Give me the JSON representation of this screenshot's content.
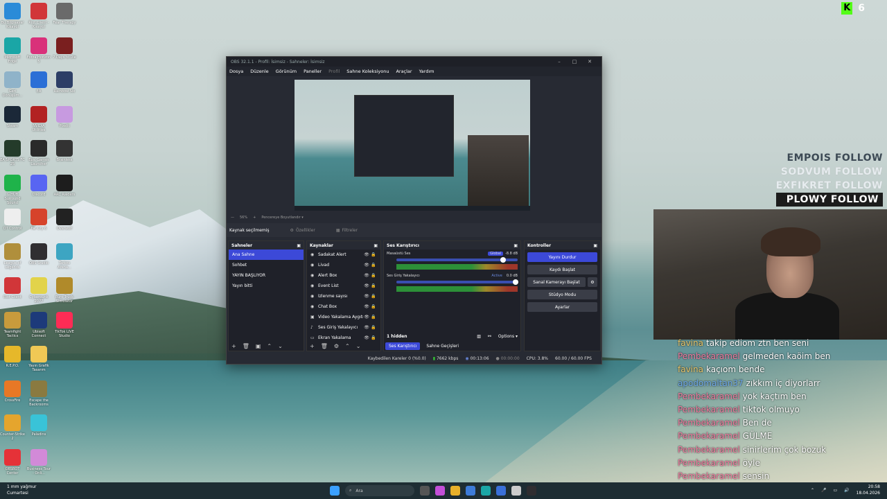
{
  "desktop": {
    "icons": [
      {
        "label": "Bu Bilgisayar Kısayol",
        "color": "#2a8bd8"
      },
      {
        "label": "Riot Client - Kısayol",
        "color": "#d13639"
      },
      {
        "label": "Fear Therapy",
        "color": "#6a6a6a"
      },
      {
        "label": "Microsoft Edge",
        "color": "#1aa6a6"
      },
      {
        "label": "Forza Horizon 5",
        "color": "#d9317a"
      },
      {
        "label": "7 Days to Die",
        "color": "#7a1f1f"
      },
      {
        "label": "Geri Dönüşüm...",
        "color": "#8fb3c9"
      },
      {
        "label": "EA",
        "color": "#2b6fd6"
      },
      {
        "label": "Rainbow Six",
        "color": "#2c3e66"
      },
      {
        "label": "Steam",
        "color": "#1b2838"
      },
      {
        "label": "NVIDIA Utilities",
        "color": "#b22222"
      },
      {
        "label": "Pixelit",
        "color": "#c79ae0"
      },
      {
        "label": "EA SPORTS FC 25",
        "color": "#243b2a"
      },
      {
        "label": "Epic Games Launcher",
        "color": "#2a2a2a"
      },
      {
        "label": "Brainless",
        "color": "#333333"
      },
      {
        "label": "G HUB Surround Sound",
        "color": "#1fb34a"
      },
      {
        "label": "Discord",
        "color": "#5865f2"
      },
      {
        "label": "ARC Raiders",
        "color": "#1d1d1d"
      },
      {
        "label": "OT Control",
        "color": "#eeeeee"
      },
      {
        "label": "Far Cry 6",
        "color": "#d6432b"
      },
      {
        "label": "Overwolf",
        "color": "#222222"
      },
      {
        "label": "League of Legends",
        "color": "#b08f3c"
      },
      {
        "label": "OBS Studio",
        "color": "#302e31"
      },
      {
        "label": "Tarkov Arena...",
        "color": "#3da5c2"
      },
      {
        "label": "Riot Client",
        "color": "#d13639"
      },
      {
        "label": "Cyberpunk 2077",
        "color": "#e2d34a"
      },
      {
        "label": "Euro Truck Simulator",
        "color": "#b08a2a"
      },
      {
        "label": "Teamfight Tactics",
        "color": "#c89b3c"
      },
      {
        "label": "Ubisoft Connect",
        "color": "#1d3a7a"
      },
      {
        "label": "TikTok LIVE Studio",
        "color": "#fe2c55"
      },
      {
        "label": "R.E.P.O.",
        "color": "#e6b82a"
      },
      {
        "label": "Yayın Grafik Tasarım",
        "color": "#f0c855"
      },
      {
        "label": "CrossFire",
        "color": "#e77826"
      },
      {
        "label": "Escape the Backrooms",
        "color": "#8a7a40"
      },
      {
        "label": "Counter-Strike 2",
        "color": "#e5a52d"
      },
      {
        "label": "Paladins",
        "color": "#39c3d8"
      },
      {
        "label": "OBSBOT Center",
        "color": "#e53238"
      },
      {
        "label": "Business Tour - Onli...",
        "color": "#d28ad8"
      }
    ]
  },
  "obs": {
    "title": "OBS 32.1.1 - Profil: İsimsiz - Sahneler: İsimsiz",
    "menu": [
      "Dosya",
      "Düzenle",
      "Görünüm",
      "Paneller",
      "Profil",
      "Sahne Koleksiyonu",
      "Araçlar",
      "Yardım"
    ],
    "preview_toolbar": {
      "zoom": "56%",
      "fit": "Pencereye Boyutlandır"
    },
    "source_bar": {
      "label": "Kaynak seçilmemiş",
      "props": "Özellikler",
      "filters": "Filtreler"
    },
    "scenes": {
      "header": "Sahneler",
      "items": [
        "Ana Sahne",
        "Sohbet",
        "YAYIN BAŞLIYOR",
        "Yayın bitti"
      ],
      "active": "Ana Sahne"
    },
    "sources": {
      "header": "Kaynaklar",
      "items": [
        "Sadakat Alert",
        "Livad",
        "Alert Box",
        "Event List",
        "İzlenme sayısı",
        "Chat Box",
        "Video Yakalama Aygıtı",
        "Ses Giriş Yakalayıcı",
        "Ekran Yakalama"
      ]
    },
    "mixer": {
      "header": "Ses Karıştırıcı",
      "tracks": [
        {
          "name": "Masaüstü Ses",
          "tag": "Global",
          "db": "-8.8 dB",
          "level": 0.88
        },
        {
          "name": "Ses Giriş Yakalayıcı",
          "tag": "Active",
          "db": "0.0 dB",
          "level": 0.98
        }
      ],
      "hidden": "1 hidden",
      "options": "Options",
      "tabs": [
        "Ses Karıştırıcı",
        "Sahne Geçişleri"
      ]
    },
    "controls": {
      "header": "Kontroller",
      "buttons": [
        "Yayını Durdur",
        "Kaydı Başlat",
        "Sanal Kamerayı Başlat",
        "Stüdyo Modu",
        "Ayarlar"
      ]
    },
    "status": {
      "dropped": "Kaybedilen Kareler 0 (%0.0)",
      "bitrate": "7662 kbps",
      "stream_time": "00:13:06",
      "rec_time": "00:00:00",
      "cpu": "CPU: 3.8%",
      "fps": "60.00 / 60.00 FPS"
    }
  },
  "kick": {
    "viewers": "6"
  },
  "follows": [
    "EMPOIS FOLLOW",
    "SODVUM FOLLOW",
    "EXFIKRET FOLLOW",
    "PLOWY FOLLOW"
  ],
  "chat": [
    {
      "user": "favina",
      "msg": "takip ediom ztn ben seni",
      "cls": "favina"
    },
    {
      "user": "Pembekaramel",
      "msg": "gelmeden kaöim ben",
      "cls": "pembe"
    },
    {
      "user": "favina",
      "msg": "kaçıom bende",
      "cls": "favina"
    },
    {
      "user": "apodomaltan37",
      "msg": "zıkkım iç diyorlarr",
      "cls": "apo"
    },
    {
      "user": "Pembekaramel",
      "msg": "yok kaçtım ben",
      "cls": "pembe"
    },
    {
      "user": "Pembekaramel",
      "msg": "tiktok olmuyo",
      "cls": "pembe"
    },
    {
      "user": "Pembekaramel",
      "msg": "Ben de",
      "cls": "pembe"
    },
    {
      "user": "Pembekaramel",
      "msg": "GÜLME",
      "cls": "pembe"
    },
    {
      "user": "Pembekaramel",
      "msg": "sinirlerim çok bozuk",
      "cls": "pembe"
    },
    {
      "user": "Pembekaramel",
      "msg": "öyle",
      "cls": "pembe"
    },
    {
      "user": "Pembekaramel",
      "msg": "sensin",
      "cls": "pembe"
    }
  ],
  "taskbar": {
    "weather": "1 mm yağmur",
    "weather_day": "Cumartesi",
    "search_placeholder": "Ara",
    "time": "20:58",
    "date": "18.04.2026"
  }
}
